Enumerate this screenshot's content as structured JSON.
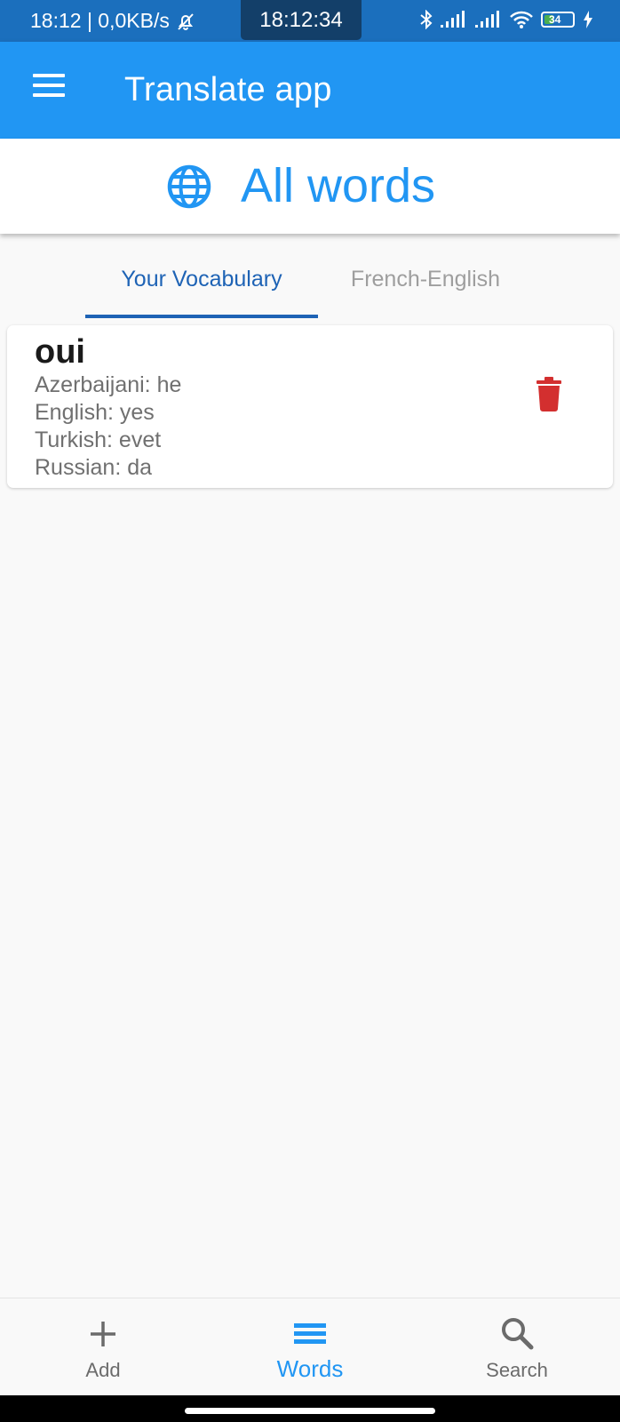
{
  "status_bar": {
    "time_left": "18:12 | 0,0KB/s",
    "clock": "18:12:34",
    "battery_level": "34",
    "battery_fraction": 0.34
  },
  "app_bar": {
    "title": "Translate app",
    "menu_icon": "menu-icon"
  },
  "page_header": {
    "title": "All words",
    "icon": "globe-icon"
  },
  "tabs": [
    {
      "label": "Your Vocabulary",
      "active": true
    },
    {
      "label": "French-English",
      "active": false
    }
  ],
  "words": [
    {
      "word": "oui",
      "translations": [
        "Azerbaijani: he",
        "English: yes",
        "Turkish: evet",
        "Russian: da"
      ],
      "delete_icon": "trash-icon"
    }
  ],
  "bottom_nav": [
    {
      "label": "Add",
      "icon": "plus-icon",
      "active": false
    },
    {
      "label": "Words",
      "icon": "list-icon",
      "active": true
    },
    {
      "label": "Search",
      "icon": "search-icon",
      "active": false
    }
  ],
  "colors": {
    "primary": "#2196f3",
    "status_bar": "#1b6fbd",
    "active_tab": "#1e63b5",
    "delete": "#d32f2f",
    "background": "#f9f9f9"
  }
}
